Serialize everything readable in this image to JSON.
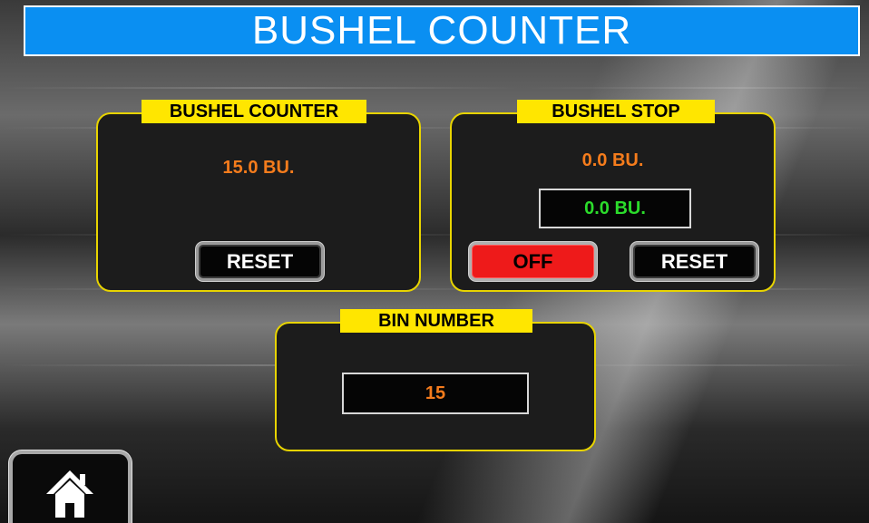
{
  "header": {
    "title": "BUSHEL COUNTER"
  },
  "bushel_counter_panel": {
    "label": "BUSHEL COUNTER",
    "value": "15.0 BU.",
    "reset_label": "RESET"
  },
  "bushel_stop_panel": {
    "label": "BUSHEL STOP",
    "current_value": "0.0 BU.",
    "setpoint_value": "0.0 BU.",
    "toggle_label": "OFF",
    "reset_label": "RESET"
  },
  "bin_number_panel": {
    "label": "BIN NUMBER",
    "value": "15"
  },
  "footer": {
    "home_icon": "home-icon"
  },
  "colors": {
    "title_bar": "#0a8ff2",
    "panel_border": "#e8d400",
    "panel_label_bg": "#ffe600",
    "value_orange": "#f57c1c",
    "value_green": "#2bdc2b",
    "off_button": "#ee1a1a"
  }
}
